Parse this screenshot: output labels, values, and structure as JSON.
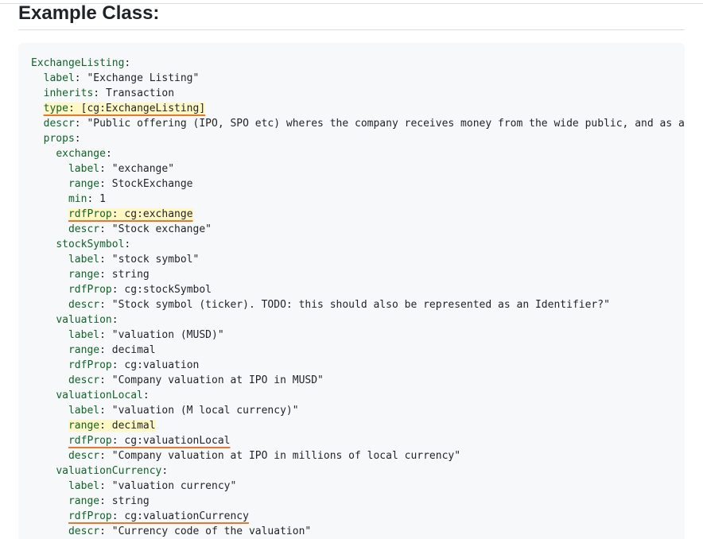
{
  "heading": "Example Class:",
  "lines": [
    {
      "indent": "",
      "key": "ExchangeListing",
      "sep": ":",
      "value": ""
    },
    {
      "indent": "  ",
      "key": "label",
      "sep": ": ",
      "value": "\"Exchange Listing\""
    },
    {
      "indent": "  ",
      "key": "inherits",
      "sep": ": ",
      "value": "Transaction"
    },
    {
      "indent": "  ",
      "key": "type",
      "sep": ": ",
      "value": "[cg:ExchangeListing]",
      "highlight": true,
      "underline": true
    },
    {
      "indent": "  ",
      "key": "descr",
      "sep": ": ",
      "value": "\"Public offering (IPO, SPO etc) wheres the company receives money from the wide public, and as a resu"
    },
    {
      "indent": "  ",
      "key": "props",
      "sep": ":",
      "value": ""
    },
    {
      "indent": "    ",
      "key": "exchange",
      "sep": ":",
      "value": ""
    },
    {
      "indent": "      ",
      "key": "label",
      "sep": ": ",
      "value": "\"exchange\""
    },
    {
      "indent": "      ",
      "key": "range",
      "sep": ": ",
      "value": "StockExchange"
    },
    {
      "indent": "      ",
      "key": "min",
      "sep": ": ",
      "value": "1"
    },
    {
      "indent": "      ",
      "key": "rdfProp",
      "sep": ": ",
      "value": "cg:exchange",
      "highlight": true,
      "underline": true
    },
    {
      "indent": "      ",
      "key": "descr",
      "sep": ": ",
      "value": "\"Stock exchange\""
    },
    {
      "indent": "    ",
      "key": "stockSymbol",
      "sep": ":",
      "value": ""
    },
    {
      "indent": "      ",
      "key": "label",
      "sep": ": ",
      "value": "\"stock symbol\""
    },
    {
      "indent": "      ",
      "key": "range",
      "sep": ": ",
      "value": "string"
    },
    {
      "indent": "      ",
      "key": "rdfProp",
      "sep": ": ",
      "value": "cg:stockSymbol"
    },
    {
      "indent": "      ",
      "key": "descr",
      "sep": ": ",
      "value": "\"Stock symbol (ticker). TODO: this should also be represented as an Identifier?\""
    },
    {
      "indent": "    ",
      "key": "valuation",
      "sep": ":",
      "value": ""
    },
    {
      "indent": "      ",
      "key": "label",
      "sep": ": ",
      "value": "\"valuation (MUSD)\""
    },
    {
      "indent": "      ",
      "key": "range",
      "sep": ": ",
      "value": "decimal"
    },
    {
      "indent": "      ",
      "key": "rdfProp",
      "sep": ": ",
      "value": "cg:valuation"
    },
    {
      "indent": "      ",
      "key": "descr",
      "sep": ": ",
      "value": "\"Company valuation at IPO in MUSD\""
    },
    {
      "indent": "    ",
      "key": "valuationLocal",
      "sep": ":",
      "value": ""
    },
    {
      "indent": "      ",
      "key": "label",
      "sep": ": ",
      "value": "\"valuation (M local currency)\""
    },
    {
      "indent": "      ",
      "key": "range",
      "sep": ": ",
      "value": "decimal",
      "highlight": true
    },
    {
      "indent": "      ",
      "key": "rdfProp",
      "sep": ": ",
      "value": "cg:valuationLocal",
      "underline": true
    },
    {
      "indent": "      ",
      "key": "descr",
      "sep": ": ",
      "value": "\"Company valuation at IPO in millions of local currency\""
    },
    {
      "indent": "    ",
      "key": "valuationCurrency",
      "sep": ":",
      "value": ""
    },
    {
      "indent": "      ",
      "key": "label",
      "sep": ": ",
      "value": "\"valuation currency\""
    },
    {
      "indent": "      ",
      "key": "range",
      "sep": ": ",
      "value": "string"
    },
    {
      "indent": "      ",
      "key": "rdfProp",
      "sep": ": ",
      "value": "cg:valuationCurrency",
      "underline": true
    },
    {
      "indent": "      ",
      "key": "descr",
      "sep": ": ",
      "value": "\"Currency code of the valuation\""
    }
  ],
  "colors": {
    "key": "#116329",
    "highlight": "#fff8c5",
    "underline": "#e8772e",
    "code_background": "#f6f8fa"
  }
}
